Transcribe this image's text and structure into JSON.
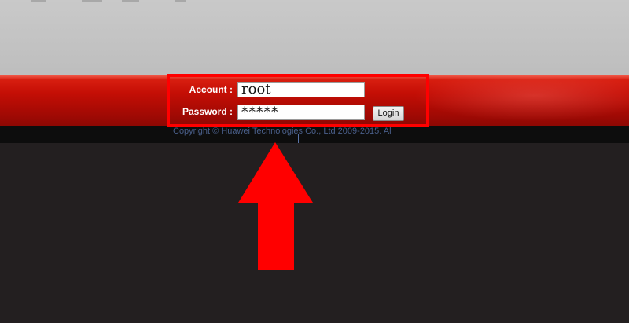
{
  "login": {
    "account_label": "Account :",
    "password_label": "Password :",
    "account_value": "root",
    "password_value": "*****",
    "login_button": "Login"
  },
  "footer": {
    "copyright": "Copyright © Huawei Technologies Co., Ltd 2009-2015. Al"
  },
  "colors": {
    "band_red": "#c40e05",
    "highlight": "#ff0000",
    "arrow": "#ff0000"
  },
  "icons": {
    "annotation_arrow": "up-arrow-icon"
  }
}
